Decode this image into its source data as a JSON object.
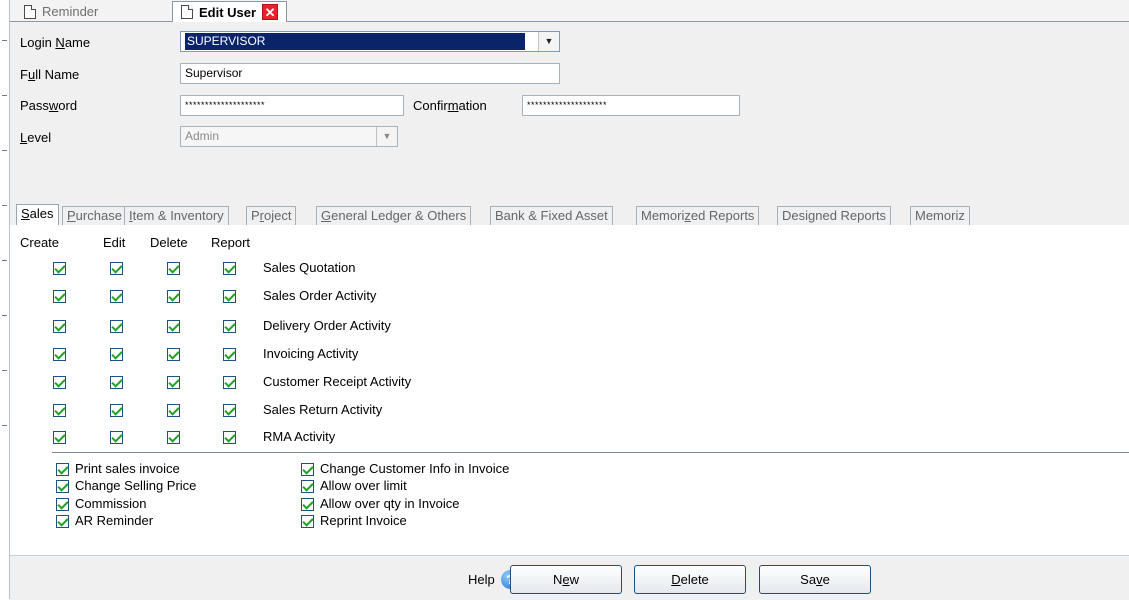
{
  "tabs": [
    {
      "label": "Reminder",
      "active": false
    },
    {
      "label": "Edit User",
      "active": true,
      "closable": true
    }
  ],
  "form": {
    "login_name": {
      "label": "Login Name",
      "value": "SUPERVISOR"
    },
    "full_name": {
      "label": "Full Name",
      "value": "Supervisor"
    },
    "password": {
      "label": "Password",
      "value": "********************"
    },
    "confirmation": {
      "label": "Confirmation",
      "value": "********************"
    },
    "level": {
      "label": "Level",
      "value": "Admin"
    }
  },
  "section_tabs": [
    "Sales",
    "Purchase",
    "Item & Inventory",
    "Project",
    "General Ledger & Others",
    "Bank & Fixed Asset",
    "Memorized Reports",
    "Designed Reports",
    "Memoriz"
  ],
  "permission_table": {
    "columns": [
      "Create",
      "Edit",
      "Delete",
      "Report"
    ],
    "rows": [
      {
        "label": "Sales Quotation",
        "create": true,
        "edit": true,
        "delete": true,
        "report": true
      },
      {
        "label": "Sales Order Activity",
        "create": true,
        "edit": true,
        "delete": true,
        "report": true
      },
      {
        "label": "Delivery Order Activity",
        "create": true,
        "edit": true,
        "delete": true,
        "report": true
      },
      {
        "label": "Invoicing Activity",
        "create": true,
        "edit": true,
        "delete": true,
        "report": true
      },
      {
        "label": "Customer Receipt Activity",
        "create": true,
        "edit": true,
        "delete": true,
        "report": true
      },
      {
        "label": "Sales Return Activity",
        "create": true,
        "edit": true,
        "delete": true,
        "report": true
      },
      {
        "label": "RMA Activity",
        "create": true,
        "edit": true,
        "delete": true,
        "report": true
      }
    ]
  },
  "options": [
    {
      "label": "Print sales invoice",
      "checked": true
    },
    {
      "label": "Change Selling Price",
      "checked": true
    },
    {
      "label": "Commission",
      "checked": true
    },
    {
      "label": "AR Reminder",
      "checked": true
    },
    {
      "label": "Change Customer Info in Invoice",
      "checked": true
    },
    {
      "label": "Allow over limit",
      "checked": true
    },
    {
      "label": "Allow over qty in Invoice",
      "checked": true
    },
    {
      "label": "Reprint Invoice",
      "checked": true
    }
  ],
  "buttons": {
    "help": "Help",
    "new": "New",
    "delete": "Delete",
    "save": "Save"
  },
  "colors": {
    "selection": "#0a246a",
    "close": "#e8212b",
    "check": "#21a121"
  }
}
